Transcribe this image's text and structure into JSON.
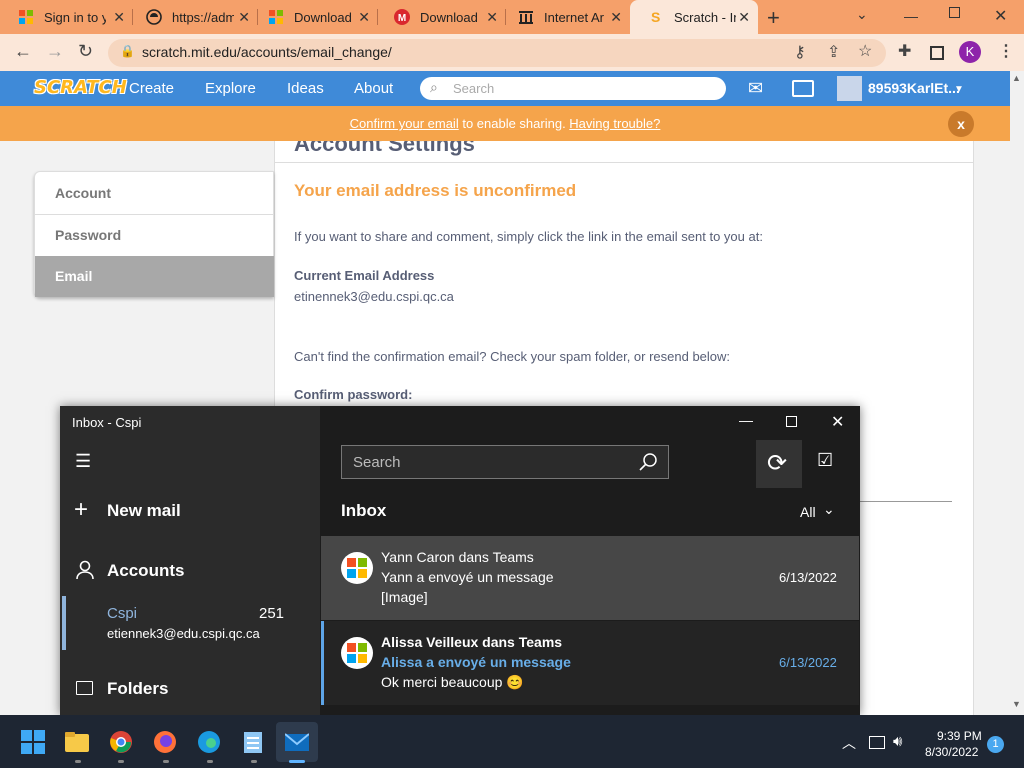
{
  "browser": {
    "tabs": [
      {
        "title": "Sign in to y",
        "icon": "microsoft-icon"
      },
      {
        "title": "https://adm",
        "icon": "globe-icon"
      },
      {
        "title": "Download",
        "icon": "microsoft-icon"
      },
      {
        "title": "Download",
        "icon": "mega-icon"
      },
      {
        "title": "Internet Ar",
        "icon": "archive-icon"
      },
      {
        "title": "Scratch - In",
        "icon": "scratch-icon"
      }
    ],
    "url": "scratch.mit.edu/accounts/email_change/",
    "profile_letter": "K"
  },
  "scratch": {
    "logo": "SCRATCH",
    "nav": [
      "Create",
      "Explore",
      "Ideas",
      "About"
    ],
    "search_placeholder": "Search",
    "username": "89593KarlEt...",
    "banner": {
      "link1": "Confirm your email",
      "middle": " to enable sharing. ",
      "link2": "Having trouble?",
      "close": "x"
    },
    "sidebar": [
      "Account",
      "Password",
      "Email"
    ],
    "page_title": "Account Settings",
    "heading": "Your email address is unconfirmed",
    "instruction": "If you want to share and comment, simply click the link in the email sent to you at:",
    "current_label": "Current Email Address",
    "current_email": "etinennek3@edu.cspi.qc.ca",
    "spam_text": "Can't find the confirmation email? Check your spam folder, or resend below:",
    "confirm_label": "Confirm password:"
  },
  "mail": {
    "window_title": "Inbox - Cspi",
    "new_mail": "New mail",
    "accounts_label": "Accounts",
    "account_name": "Cspi",
    "account_count": "251",
    "account_email": "etiennek3@edu.cspi.qc.ca",
    "folders_label": "Folders",
    "search_placeholder": "Search",
    "inbox_label": "Inbox",
    "filter": "All",
    "messages": [
      {
        "sender": "Yann Caron dans Teams",
        "subject": "Yann a envoyé un message",
        "preview": "[Image]",
        "date": "6/13/2022"
      },
      {
        "sender": "Alissa Veilleux dans Teams",
        "subject": "Alissa a envoyé un message",
        "preview": "Ok merci beaucoup 😊",
        "date": "6/13/2022"
      }
    ]
  },
  "taskbar": {
    "time": "9:39 PM",
    "date": "8/30/2022",
    "notification_count": "1"
  }
}
